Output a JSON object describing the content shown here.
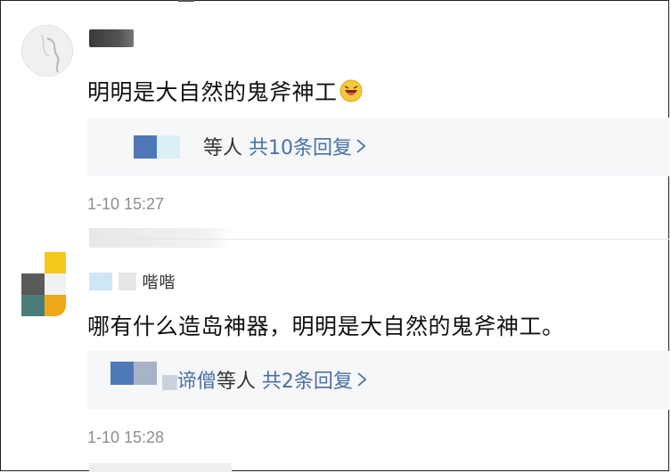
{
  "comments": [
    {
      "text": "明明是大自然的鬼斧神工",
      "emoji": "laughing-emoji",
      "replies": {
        "who_suffix": "等人",
        "link": "共10条回复"
      },
      "time": "1-10 15:27"
    },
    {
      "username_partial": "喈喈",
      "text": "哪有什么造岛神器，明明是大自然的鬼斧神工。",
      "replies": {
        "name_partial": "谛僧",
        "who_suffix": "等人",
        "link": "共2条回复"
      },
      "time": "1-10 15:28"
    }
  ],
  "colors": {
    "link": "#4a71a6",
    "time": "#8e8e8e",
    "reply_bg": "#f6f7f9"
  },
  "icons": {
    "chevron": "chevron-right-icon"
  }
}
